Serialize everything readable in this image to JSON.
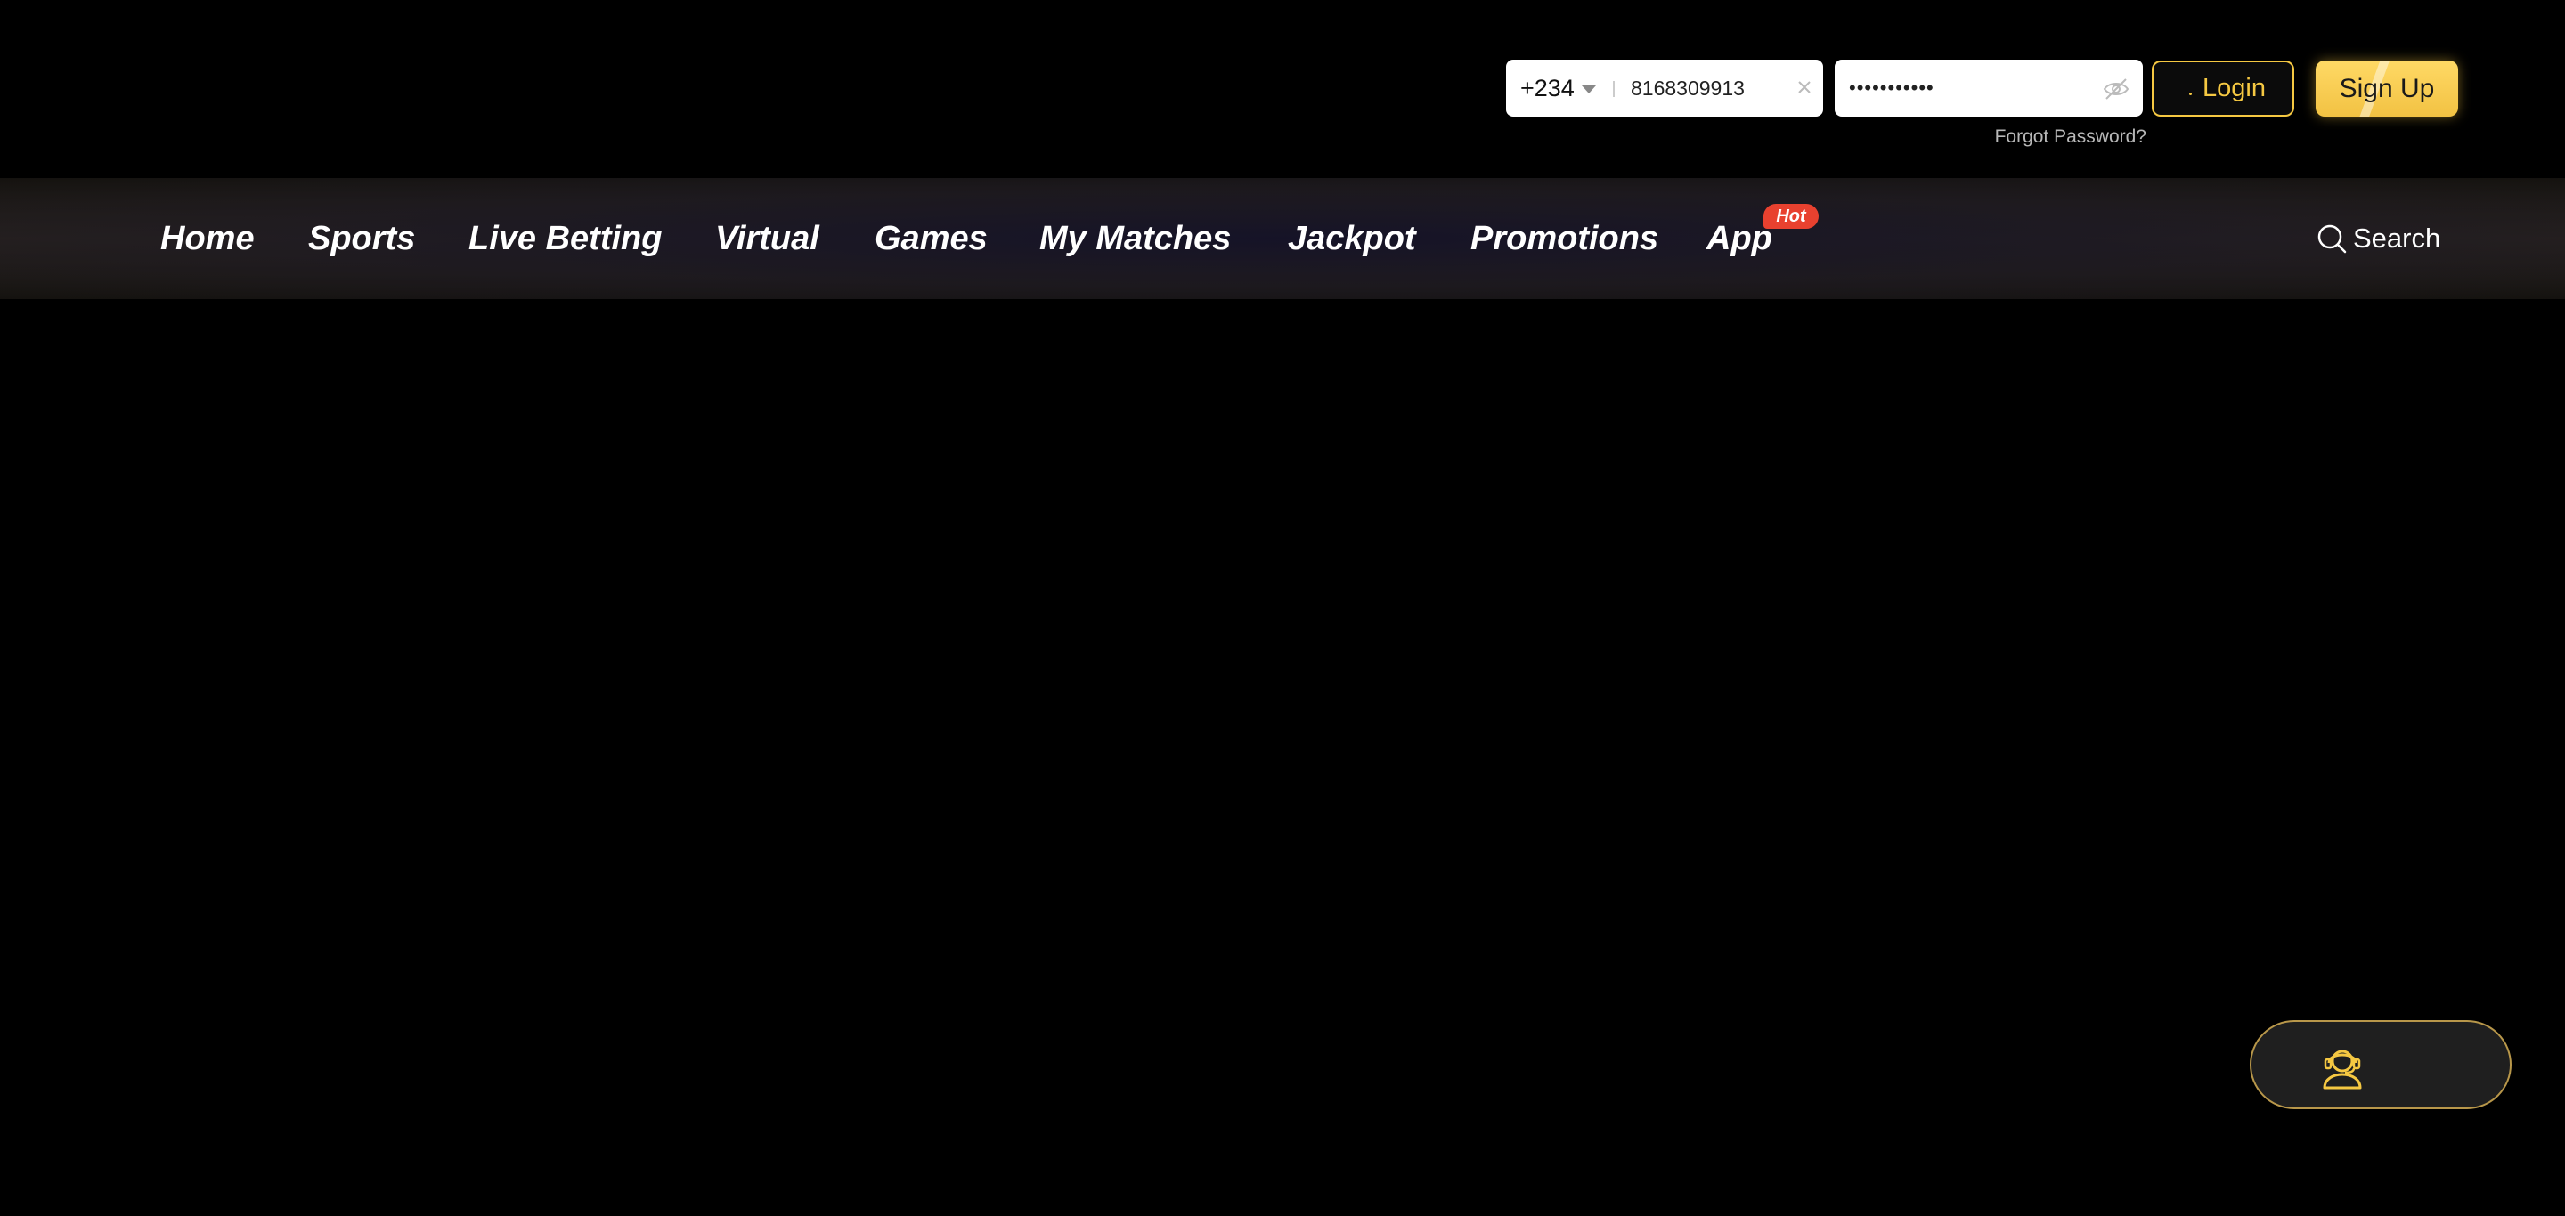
{
  "login": {
    "country_code": "+234",
    "phone_value": "8168309913",
    "password_value": "•••••••••••",
    "login_label": "Login",
    "signup_label": "Sign Up",
    "forgot_label": "Forgot Password?"
  },
  "nav": {
    "items": [
      {
        "label": "Home"
      },
      {
        "label": "Sports"
      },
      {
        "label": "Live Betting"
      },
      {
        "label": "Virtual"
      },
      {
        "label": "Games"
      },
      {
        "label": "My Matches"
      },
      {
        "label": "Jackpot"
      },
      {
        "label": "Promotions"
      },
      {
        "label": "App"
      }
    ],
    "hot_badge": "Hot",
    "search_label": "Search"
  },
  "icons": {
    "phone_clear": "close-icon",
    "password_toggle": "eye-off-icon",
    "search": "search-icon",
    "support": "headset-support-icon",
    "country_dropdown": "caret-down-icon"
  },
  "colors": {
    "background": "#000000",
    "accent_gold": "#f5c842",
    "hot_red": "#e8412f",
    "support_border": "#b8974a"
  }
}
